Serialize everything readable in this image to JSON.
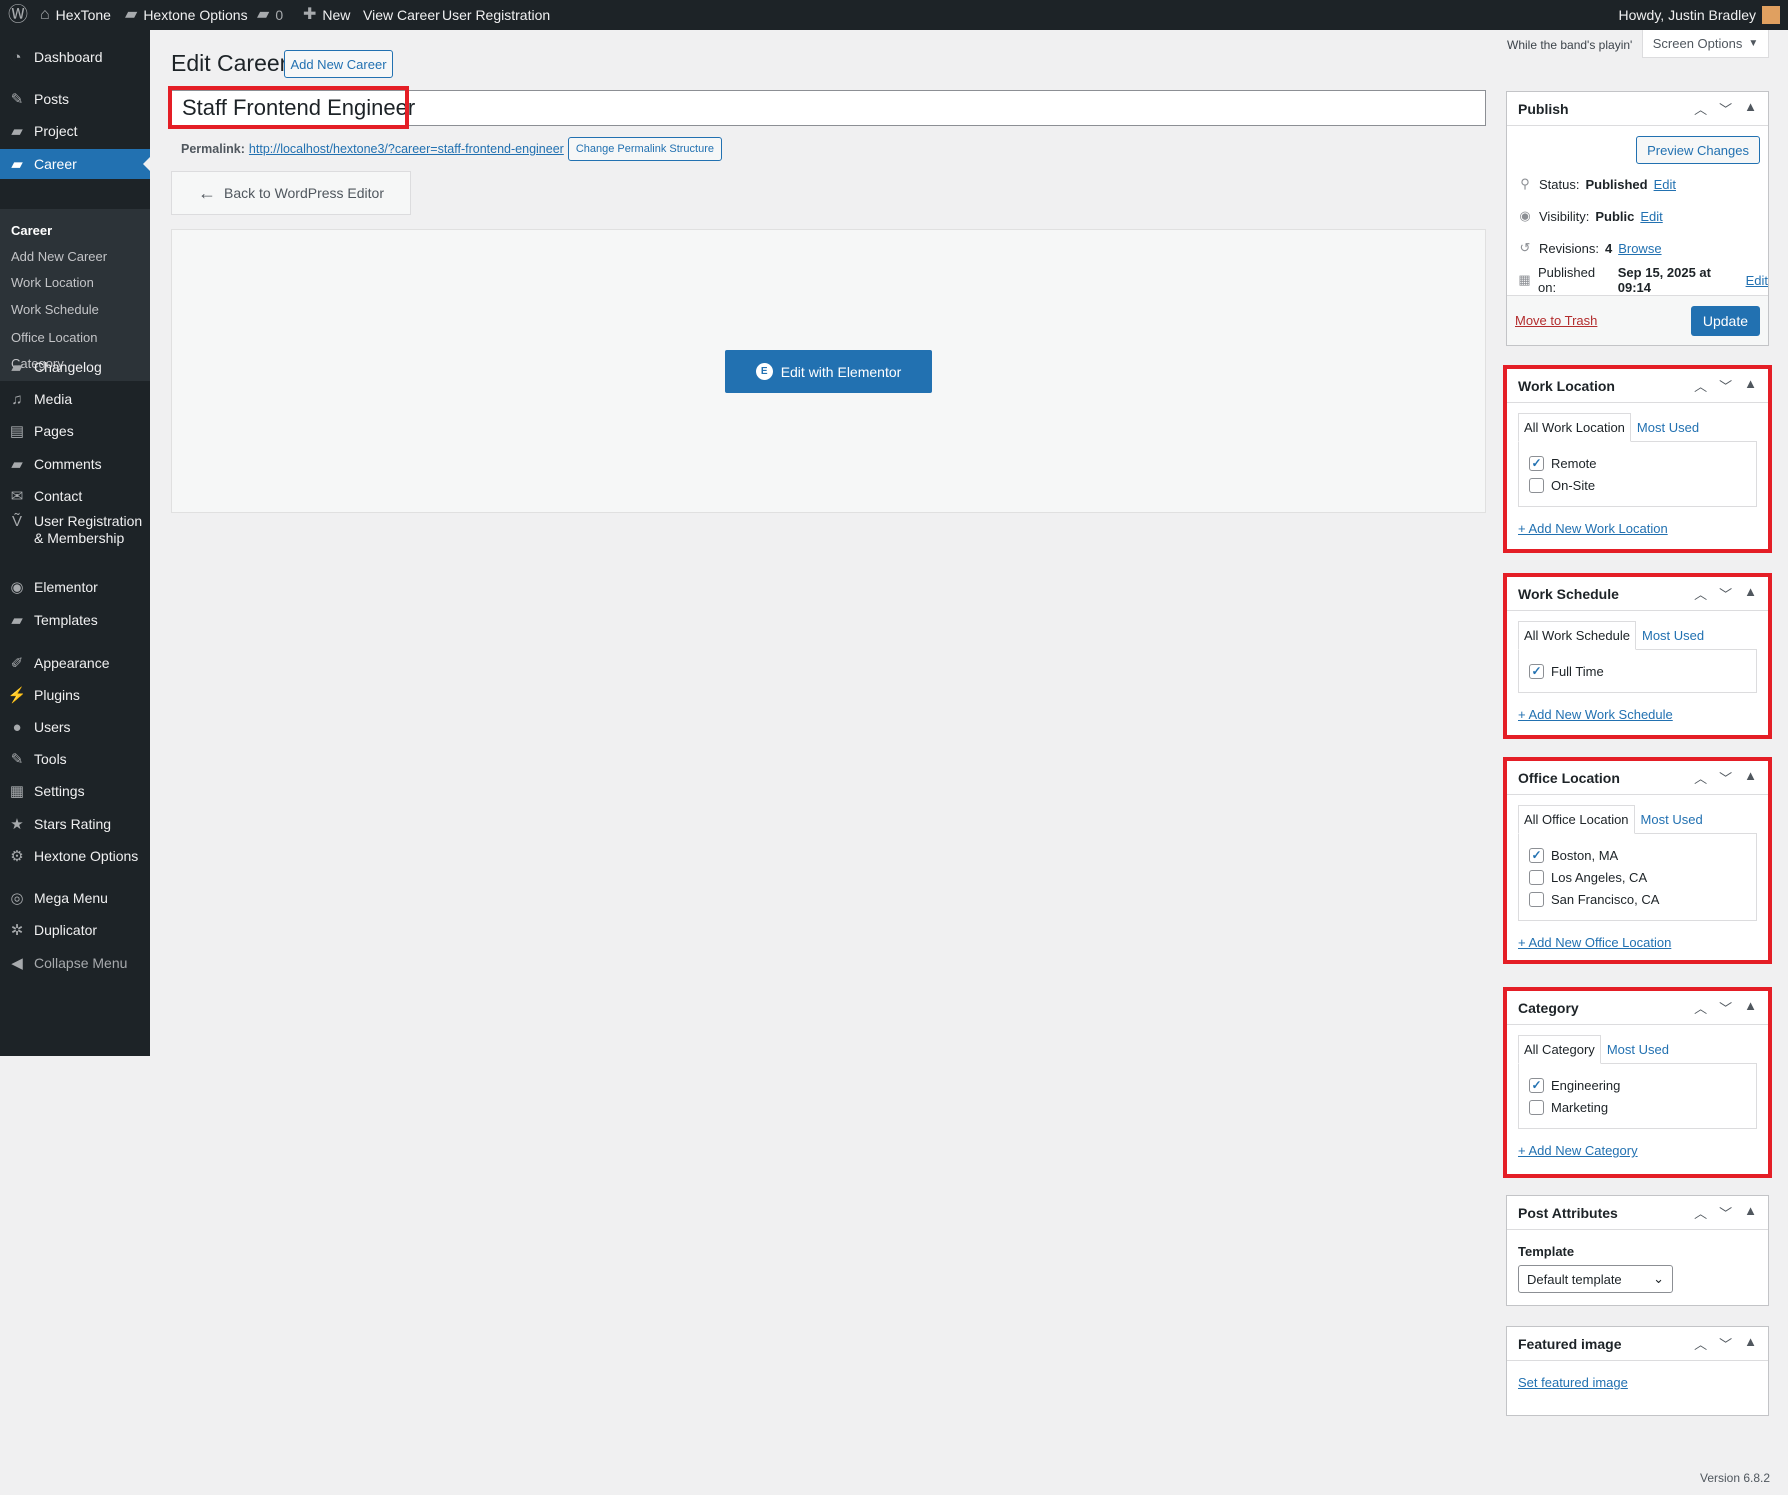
{
  "adminbar": {
    "site": "HexTone",
    "options": "Hextone Options",
    "comments": "0",
    "new": "New",
    "view": "View Career",
    "userreg": "User Registration",
    "howdy": "Howdy, Justin Bradley"
  },
  "sidebar": {
    "items": [
      {
        "label": "Dashboard",
        "icon": "dashboard-icon",
        "glyph": "◔"
      },
      {
        "label": "Posts",
        "icon": "pin-icon",
        "glyph": "✎"
      },
      {
        "label": "Project",
        "icon": "folder-icon",
        "glyph": "▰"
      },
      {
        "label": "Career",
        "icon": "folder-icon",
        "glyph": "▰"
      },
      {
        "label": "Changelog",
        "icon": "folder-icon",
        "glyph": "▰"
      },
      {
        "label": "Media",
        "icon": "media-icon",
        "glyph": "♫"
      },
      {
        "label": "Pages",
        "icon": "pages-icon",
        "glyph": "▤"
      },
      {
        "label": "Comments",
        "icon": "comment-icon",
        "glyph": "▰"
      },
      {
        "label": "Contact",
        "icon": "mail-icon",
        "glyph": "✉"
      },
      {
        "label": "User Registration & Membership",
        "icon": "user-registration-icon",
        "glyph": "Ṽ"
      },
      {
        "label": "Elementor",
        "icon": "elementor-icon",
        "glyph": "◉"
      },
      {
        "label": "Templates",
        "icon": "folder-open-icon",
        "glyph": "▰"
      },
      {
        "label": "Appearance",
        "icon": "brush-icon",
        "glyph": "✐"
      },
      {
        "label": "Plugins",
        "icon": "plugin-icon",
        "glyph": "⚡"
      },
      {
        "label": "Users",
        "icon": "user-icon",
        "glyph": "●"
      },
      {
        "label": "Tools",
        "icon": "wrench-icon",
        "glyph": "✎"
      },
      {
        "label": "Settings",
        "icon": "settings-icon",
        "glyph": "▦"
      },
      {
        "label": "Stars Rating",
        "icon": "star-icon",
        "glyph": "★"
      },
      {
        "label": "Hextone Options",
        "icon": "gear-icon",
        "glyph": "⚙"
      },
      {
        "label": "Mega Menu",
        "icon": "mega-menu-icon",
        "glyph": "◎"
      },
      {
        "label": "Duplicator",
        "icon": "duplicator-icon",
        "glyph": "✲"
      },
      {
        "label": "Collapse Menu",
        "icon": "collapse-icon",
        "glyph": "◀"
      }
    ],
    "submenu": [
      "Career",
      "Add New Career",
      "Work Location",
      "Work Schedule",
      "Office Location",
      "Category"
    ]
  },
  "header": {
    "title": "Edit Career",
    "add_new": "Add New Career",
    "tagline": "While the band's playin'",
    "screen_options": "Screen Options"
  },
  "post": {
    "title": "Staff Frontend Engineer",
    "permalink_label": "Permalink:",
    "permalink": "http://localhost/hextone3/?career=staff-frontend-engineer",
    "change_permalink": "Change Permalink Structure",
    "back": "Back to WordPress Editor",
    "elementor": "Edit with Elementor"
  },
  "publish": {
    "title": "Publish",
    "preview": "Preview Changes",
    "status_label": "Status:",
    "status": "Published",
    "visibility_label": "Visibility:",
    "visibility": "Public",
    "revisions_label": "Revisions:",
    "revisions": "4",
    "browse": "Browse",
    "published_label": "Published on:",
    "published": "Sep 15, 2025 at 09:14",
    "edit": "Edit",
    "trash": "Move to Trash",
    "update": "Update"
  },
  "taxonomies": [
    {
      "title": "Work Location",
      "tab_all": "All Work Location",
      "tab_most": "Most Used",
      "items": [
        {
          "label": "Remote",
          "checked": true
        },
        {
          "label": "On-Site",
          "checked": false
        }
      ],
      "add": "+ Add New Work Location"
    },
    {
      "title": "Work Schedule",
      "tab_all": "All Work Schedule",
      "tab_most": "Most Used",
      "items": [
        {
          "label": "Full Time",
          "checked": true
        }
      ],
      "add": "+ Add New Work Schedule"
    },
    {
      "title": "Office Location",
      "tab_all": "All Office Location",
      "tab_most": "Most Used",
      "items": [
        {
          "label": "Boston, MA",
          "checked": true
        },
        {
          "label": "Los Angeles, CA",
          "checked": false
        },
        {
          "label": "San Francisco, CA",
          "checked": false
        }
      ],
      "add": "+ Add New Office Location"
    },
    {
      "title": "Category",
      "tab_all": "All Category",
      "tab_most": "Most Used",
      "items": [
        {
          "label": "Engineering",
          "checked": true
        },
        {
          "label": "Marketing",
          "checked": false
        }
      ],
      "add": "+ Add New Category"
    }
  ],
  "attributes": {
    "title": "Post Attributes",
    "template_label": "Template",
    "template": "Default template"
  },
  "featured": {
    "title": "Featured image",
    "set": "Set featured image"
  },
  "footer": {
    "version": "Version 6.8.2"
  }
}
